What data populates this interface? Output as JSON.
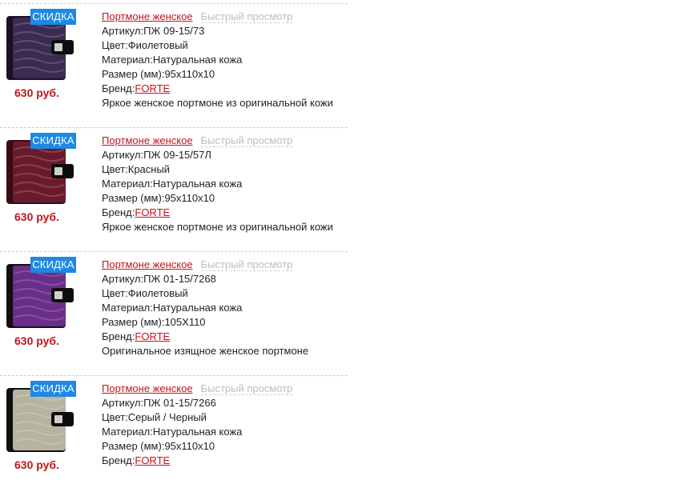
{
  "labels": {
    "badge": "СКИДКА",
    "quick_view": "Быстрый просмотр",
    "article_prefix": "Артикул:",
    "color_prefix": "Цвет:",
    "material_prefix": "Материал:",
    "size_prefix": "Размер (мм):",
    "brand_prefix": "Бренд:"
  },
  "products": [
    {
      "category": "Портмоне женское",
      "article": "ПЖ 09-15/73",
      "color": "Фиолетовый",
      "material": "Натуральная кожа",
      "size": "95x110x10",
      "brand": "FORTE",
      "description": "Яркое женское портмоне из оригинальной кожи",
      "price": "630 руб.",
      "image_colors": [
        "#3b2a52",
        "#1b1226"
      ]
    },
    {
      "category": "Портмоне женское",
      "article": "ПЖ 09-15/57Л",
      "color": "Красный",
      "material": "Натуральная кожа",
      "size": "95x110x10",
      "brand": "FORTE",
      "description": "Яркое женское портмоне из оригинальной кожи",
      "price": "630 руб.",
      "image_colors": [
        "#6b1a2c",
        "#3a0c16"
      ]
    },
    {
      "category": "Портмоне женское",
      "article": "ПЖ 01-15/7268",
      "color": "Фиолетовый",
      "material": "Натуральная кожа",
      "size": "105X110",
      "brand": "FORTE",
      "description": "Оригинальное изящное женское портмоне",
      "price": "630 руб.",
      "image_colors": [
        "#6a2d8a",
        "#111111"
      ]
    },
    {
      "category": "Портмоне женское",
      "article": "ПЖ 01-15/7266",
      "color": "Серый / Черный",
      "material": "Натуральная кожа",
      "size": "95x110x10",
      "brand": "FORTE",
      "description": "",
      "price": "630 руб.",
      "image_colors": [
        "#b7b3a1",
        "#111111"
      ]
    }
  ]
}
